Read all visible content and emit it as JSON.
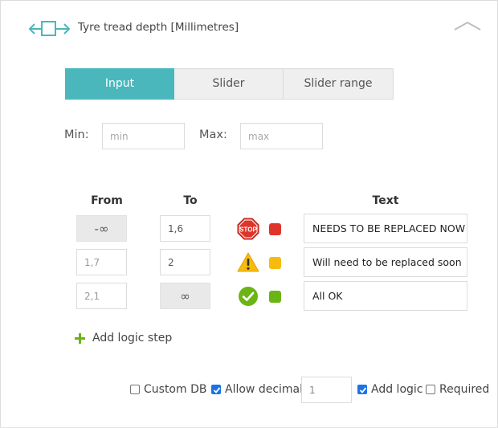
{
  "header": {
    "title": "Tyre tread depth [Millimetres]",
    "field_icon": "range-arrows-icon",
    "collapse_icon": "chevron-up-icon"
  },
  "tabs": [
    {
      "label": "Input",
      "active": true
    },
    {
      "label": "Slider",
      "active": false
    },
    {
      "label": "Slider range",
      "active": false
    }
  ],
  "min": {
    "label": "Min:",
    "placeholder": "min",
    "value": ""
  },
  "max": {
    "label": "Max:",
    "placeholder": "max",
    "value": ""
  },
  "table": {
    "headers": {
      "from": "From",
      "to": "To",
      "text": "Text"
    },
    "rows": [
      {
        "from": "-∞",
        "to": "1,6",
        "icon": "stop-sign-icon",
        "color": "#e0342b",
        "text": "NEEDS TO BE REPLACED NOW"
      },
      {
        "from": "1,7",
        "to": "2",
        "icon": "warning-icon",
        "color": "#f7bb0e",
        "text": "Will need to be replaced soon"
      },
      {
        "from": "2,1",
        "to": "∞",
        "icon": "check-circle-icon",
        "color": "#6ab515",
        "text": "All OK"
      }
    ]
  },
  "add_logic_step": {
    "label": "Add logic step",
    "icon": "plus-icon"
  },
  "options": {
    "custom_db": {
      "label": "Custom DB",
      "checked": false
    },
    "allow_decimal": {
      "label": "Allow decimal",
      "checked": true
    },
    "decimals": {
      "value": "1"
    },
    "add_logic": {
      "label": "Add logic",
      "checked": true
    },
    "required": {
      "label": "Required",
      "checked": false
    }
  },
  "colors": {
    "accent": "#4ab7bd",
    "stop": "#e0342b",
    "warning": "#f7bb0e",
    "ok": "#6ab515",
    "checkbox": "#1a73e8"
  }
}
